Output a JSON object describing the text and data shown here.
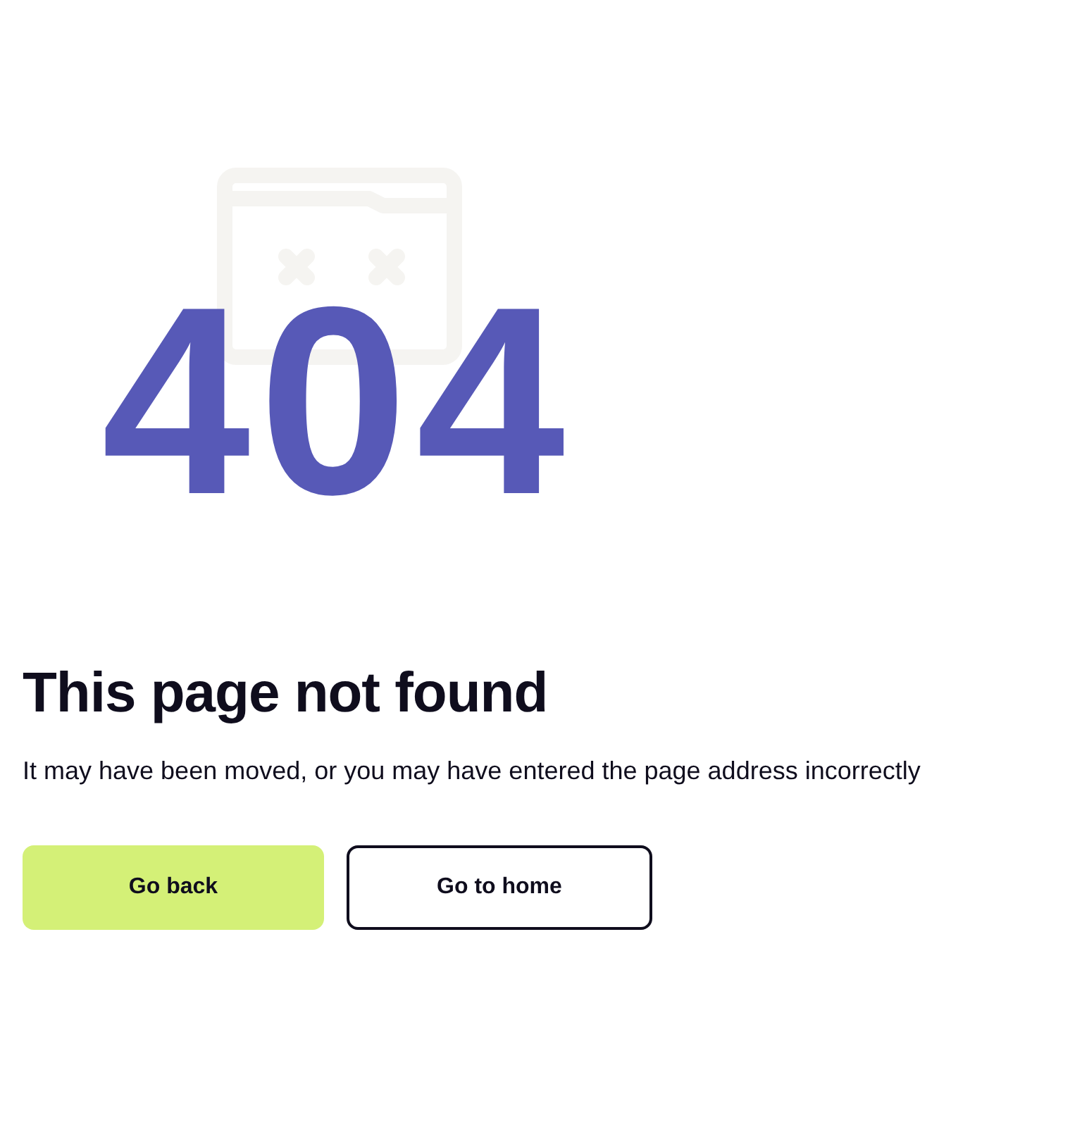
{
  "error_code": "404",
  "title": "This page not found",
  "message": "It may have been moved, or you may have entered the page address incorrectly",
  "buttons": [
    {
      "label": "Go back",
      "kind": "primary"
    },
    {
      "label": "Go to home",
      "kind": "secondary"
    }
  ]
}
